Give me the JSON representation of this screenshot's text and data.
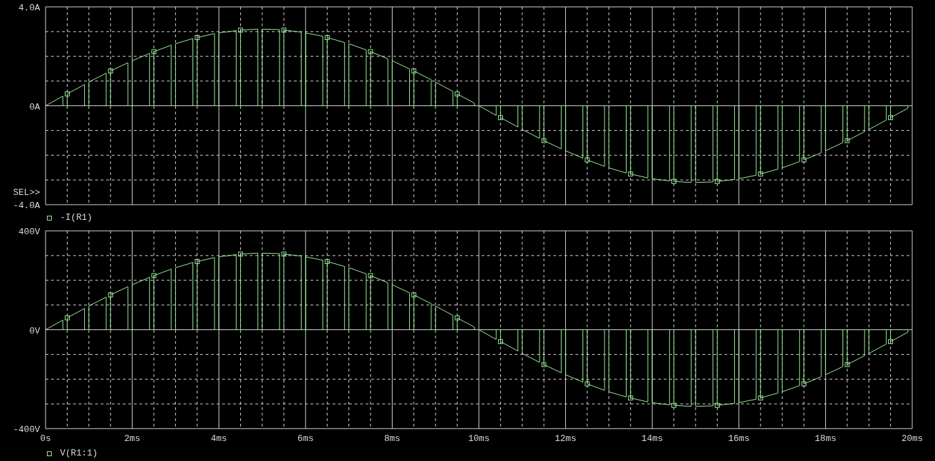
{
  "charts": [
    {
      "selection_marker": "SEL>>",
      "chart_data": {
        "type": "line",
        "grid": true,
        "x": [
          0,
          0,
          0.4,
          0.4,
          0.5,
          0.5,
          0.9,
          0.9,
          1,
          1,
          1.4,
          1.4,
          1.5,
          1.5,
          1.9,
          1.9,
          2,
          2,
          2.4,
          2.4,
          2.5,
          2.5,
          2.9,
          2.9,
          3,
          3,
          3.4,
          3.4,
          3.5,
          3.5,
          3.9,
          3.9,
          4,
          4,
          4.4,
          4.4,
          4.5,
          4.5,
          4.9,
          4.9,
          5,
          5,
          5.4,
          5.4,
          5.5,
          5.5,
          5.9,
          5.9,
          6,
          6,
          6.4,
          6.4,
          6.5,
          6.5,
          6.9,
          6.9,
          7,
          7,
          7.4,
          7.4,
          7.5,
          7.5,
          7.9,
          7.9,
          8,
          8,
          8.4,
          8.4,
          8.5,
          8.5,
          8.9,
          8.9,
          9,
          9,
          9.4,
          9.4,
          9.5,
          9.5,
          9.9,
          9.9,
          10,
          10,
          10.4,
          10.4,
          10.5,
          10.5,
          10.9,
          10.9,
          11,
          11,
          11.4,
          11.4,
          11.5,
          11.5,
          11.9,
          11.9,
          12,
          12,
          12.4,
          12.4,
          12.5,
          12.5,
          12.9,
          12.9,
          13,
          13,
          13.4,
          13.4,
          13.5,
          13.5,
          13.9,
          13.9,
          14,
          14,
          14.4,
          14.4,
          14.5,
          14.5,
          14.9,
          14.9,
          15,
          15,
          15.4,
          15.4,
          15.5,
          15.5,
          15.9,
          15.9,
          16,
          16,
          16.4,
          16.4,
          16.5,
          16.5,
          16.9,
          16.9,
          17,
          17,
          17.4,
          17.4,
          17.5,
          17.5,
          17.9,
          17.9,
          18,
          18,
          18.4,
          18.4,
          18.5,
          18.5,
          18.9,
          18.9,
          19,
          19,
          19.4,
          19.4,
          19.5,
          19.5,
          19.9,
          19.9,
          20
        ],
        "xlim": [
          0,
          20
        ],
        "ylim": [
          -4,
          4
        ],
        "yticks": [
          {
            "value": 4,
            "label": "4.0A"
          },
          {
            "value": 0,
            "label": "0A"
          },
          {
            "value": -4,
            "label": "-4.0A"
          }
        ],
        "series": [
          {
            "name": "-I(R1)",
            "color": "#9cf09c",
            "values": [
              0,
              0,
              0.39,
              0,
              0,
              0.48,
              0.86,
              0,
              0,
              0.96,
              1.32,
              0,
              0,
              1.41,
              1.74,
              0,
              0,
              1.82,
              2.12,
              0,
              0,
              2.19,
              2.45,
              0,
              0,
              2.51,
              2.72,
              0,
              0,
              2.76,
              2.92,
              0,
              0,
              2.95,
              3.04,
              0,
              0,
              3.06,
              3.1,
              0,
              0,
              3.1,
              3.08,
              0,
              0,
              3.06,
              2.98,
              0,
              0,
              2.95,
              2.81,
              0,
              0,
              2.76,
              2.56,
              0,
              0,
              2.51,
              2.26,
              0,
              0,
              2.19,
              1.9,
              0,
              0,
              1.82,
              1.49,
              0,
              0,
              1.41,
              1.05,
              0,
              0,
              0.96,
              0.58,
              0,
              0,
              0.48,
              0.1,
              0,
              0,
              0,
              -0.39,
              0,
              0,
              -0.48,
              -0.86,
              0,
              0,
              -0.96,
              -1.32,
              0,
              0,
              -1.41,
              -1.74,
              0,
              0,
              -1.82,
              -2.12,
              0,
              0,
              -2.19,
              -2.45,
              0,
              0,
              -2.51,
              -2.72,
              0,
              0,
              -2.76,
              -2.92,
              0,
              0,
              -2.95,
              -3.04,
              0,
              0,
              -3.06,
              -3.1,
              0,
              0,
              -3.1,
              -3.08,
              0,
              0,
              -3.06,
              -2.98,
              0,
              0,
              -2.95,
              -2.81,
              0,
              0,
              -2.76,
              -2.56,
              0,
              0,
              -2.51,
              -2.26,
              0,
              0,
              -2.19,
              -1.9,
              0,
              0,
              -1.82,
              -1.49,
              0,
              0,
              -1.41,
              -1.05,
              0,
              0,
              -0.96,
              -0.58,
              0,
              0,
              -0.48,
              -0.1,
              0,
              0
            ]
          }
        ]
      }
    },
    {
      "chart_data": {
        "type": "line",
        "grid": true,
        "x": [
          0,
          0,
          0.4,
          0.4,
          0.5,
          0.5,
          0.9,
          0.9,
          1,
          1,
          1.4,
          1.4,
          1.5,
          1.5,
          1.9,
          1.9,
          2,
          2,
          2.4,
          2.4,
          2.5,
          2.5,
          2.9,
          2.9,
          3,
          3,
          3.4,
          3.4,
          3.5,
          3.5,
          3.9,
          3.9,
          4,
          4,
          4.4,
          4.4,
          4.5,
          4.5,
          4.9,
          4.9,
          5,
          5,
          5.4,
          5.4,
          5.5,
          5.5,
          5.9,
          5.9,
          6,
          6,
          6.4,
          6.4,
          6.5,
          6.5,
          6.9,
          6.9,
          7,
          7,
          7.4,
          7.4,
          7.5,
          7.5,
          7.9,
          7.9,
          8,
          8,
          8.4,
          8.4,
          8.5,
          8.5,
          8.9,
          8.9,
          9,
          9,
          9.4,
          9.4,
          9.5,
          9.5,
          9.9,
          9.9,
          10,
          10,
          10.4,
          10.4,
          10.5,
          10.5,
          10.9,
          10.9,
          11,
          11,
          11.4,
          11.4,
          11.5,
          11.5,
          11.9,
          11.9,
          12,
          12,
          12.4,
          12.4,
          12.5,
          12.5,
          12.9,
          12.9,
          13,
          13,
          13.4,
          13.4,
          13.5,
          13.5,
          13.9,
          13.9,
          14,
          14,
          14.4,
          14.4,
          14.5,
          14.5,
          14.9,
          14.9,
          15,
          15,
          15.4,
          15.4,
          15.5,
          15.5,
          15.9,
          15.9,
          16,
          16,
          16.4,
          16.4,
          16.5,
          16.5,
          16.9,
          16.9,
          17,
          17,
          17.4,
          17.4,
          17.5,
          17.5,
          17.9,
          17.9,
          18,
          18,
          18.4,
          18.4,
          18.5,
          18.5,
          18.9,
          18.9,
          19,
          19,
          19.4,
          19.4,
          19.5,
          19.5,
          19.9,
          19.9,
          20
        ],
        "xlim": [
          0,
          20
        ],
        "ylim": [
          -400,
          400
        ],
        "xticks": [
          {
            "value": 0,
            "label": "0s"
          },
          {
            "value": 2,
            "label": "2ms"
          },
          {
            "value": 4,
            "label": "4ms"
          },
          {
            "value": 6,
            "label": "6ms"
          },
          {
            "value": 8,
            "label": "8ms"
          },
          {
            "value": 10,
            "label": "10ms"
          },
          {
            "value": 12,
            "label": "12ms"
          },
          {
            "value": 14,
            "label": "14ms"
          },
          {
            "value": 16,
            "label": "16ms"
          },
          {
            "value": 18,
            "label": "18ms"
          },
          {
            "value": 20,
            "label": "20ms"
          }
        ],
        "yticks": [
          {
            "value": 400,
            "label": "400V"
          },
          {
            "value": 0,
            "label": "0V"
          },
          {
            "value": -400,
            "label": "-400V"
          }
        ],
        "series": [
          {
            "name": "V(R1:1)",
            "color": "#9cf09c",
            "values": [
              0,
              0,
              39,
              0,
              0,
              48,
              86,
              0,
              0,
              96,
              132,
              0,
              0,
              141,
              174,
              0,
              0,
              182,
              212,
              0,
              0,
              219,
              245,
              0,
              0,
              251,
              272,
              0,
              0,
              276,
              292,
              0,
              0,
              295,
              304,
              0,
              0,
              306,
              310,
              0,
              0,
              310,
              308,
              0,
              0,
              306,
              298,
              0,
              0,
              295,
              281,
              0,
              0,
              276,
              256,
              0,
              0,
              251,
              226,
              0,
              0,
              219,
              190,
              0,
              0,
              182,
              149,
              0,
              0,
              141,
              105,
              0,
              0,
              96,
              58,
              0,
              0,
              48,
              10,
              0,
              0,
              0,
              -39,
              0,
              0,
              -48,
              -86,
              0,
              0,
              -96,
              -132,
              0,
              0,
              -141,
              -174,
              0,
              0,
              -182,
              -212,
              0,
              0,
              -219,
              -245,
              0,
              0,
              -251,
              -272,
              0,
              0,
              -276,
              -292,
              0,
              0,
              -295,
              -304,
              0,
              0,
              -306,
              -310,
              0,
              0,
              -310,
              -308,
              0,
              0,
              -306,
              -298,
              0,
              0,
              -295,
              -281,
              0,
              0,
              -276,
              -256,
              0,
              0,
              -251,
              -226,
              0,
              0,
              -219,
              -190,
              0,
              0,
              -182,
              -149,
              0,
              0,
              -141,
              -105,
              0,
              0,
              -96,
              -58,
              0,
              0,
              -48,
              -10,
              0,
              0
            ]
          }
        ]
      }
    }
  ]
}
